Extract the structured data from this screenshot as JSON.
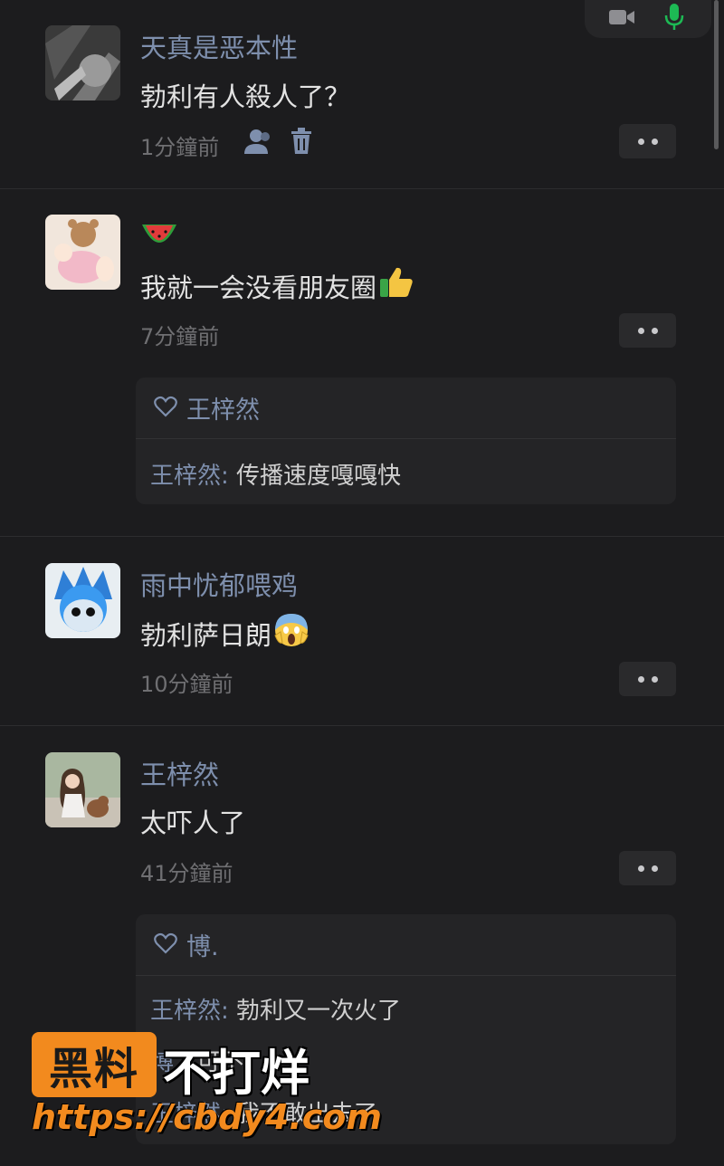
{
  "call_bar": {
    "icons": [
      "video-icon",
      "microphone-icon"
    ],
    "mic_color": "#1db954"
  },
  "comments": [
    {
      "name": "天真是恶本性",
      "text": "勃利有人殺人了？",
      "time": "1分鐘前",
      "icons": [
        "contact-icon",
        "delete-icon"
      ]
    },
    {
      "name_emoji": "watermelon",
      "text": "我就一会没看朋友圈",
      "text_emoji": "thumbs-up",
      "time": "7分鐘前",
      "reply": {
        "like_name": "王梓然",
        "lines": [
          {
            "author": "王梓然: ",
            "text": "传播速度嘎嘎快"
          }
        ]
      }
    },
    {
      "name": "雨中忧郁喂鸡",
      "text": "勃利萨日朗",
      "text_emoji": "screaming-face",
      "time": "10分鐘前"
    },
    {
      "name": "王梓然",
      "text": "太吓人了",
      "time": "41分鐘前",
      "reply": {
        "like_name": "博.",
        "lines": [
          {
            "author": "王梓然: ",
            "text": "勃利又一次火了"
          },
          {
            "author": "博.: ",
            "text": "可不"
          },
          {
            "author": "王梓然: ",
            "text": "我不敢出去了"
          }
        ]
      }
    }
  ],
  "watermark": {
    "badge": "黑料",
    "tagline": "不打烊",
    "url": "https://cbdy4.com",
    "accent": "#f28a1e"
  },
  "colors": {
    "background": "#1c1c1e",
    "name": "#7e8fad",
    "text": "#e3e3e3",
    "time": "#6f6f72"
  }
}
